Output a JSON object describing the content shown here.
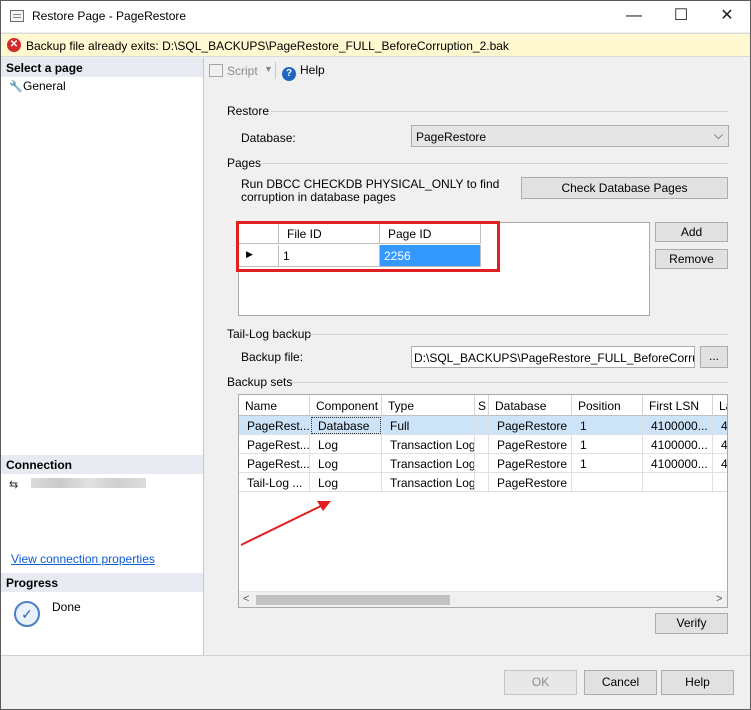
{
  "window": {
    "title": "Restore Page - PageRestore",
    "minimize": "—",
    "maximize": "☐",
    "close": "✕"
  },
  "error_bar": {
    "icon": "error-x-icon",
    "text": "Backup file already exits: D:\\SQL_BACKUPS\\PageRestore_FULL_BeforeCorruption_2.bak"
  },
  "left_panel": {
    "select_header": "Select a page",
    "pages": [
      {
        "label": "General",
        "icon": "wrench-icon"
      }
    ],
    "connection_header": "Connection",
    "connection_link": "View connection properties",
    "progress_header": "Progress",
    "progress_status": "Done"
  },
  "toolbar": {
    "script_label": "Script",
    "help_label": "Help"
  },
  "restore": {
    "section": "Restore",
    "database_label": "Database:",
    "database_value": "PageRestore"
  },
  "pages_section": {
    "section": "Pages",
    "description_line1": "Run DBCC CHECKDB PHYSICAL_ONLY to find",
    "description_line2": "corruption in database pages",
    "check_button": "Check Database Pages",
    "add_button": "Add",
    "remove_button": "Remove",
    "grid": {
      "headers": [
        "File ID",
        "Page ID"
      ],
      "row": {
        "file_id": "1",
        "page_id": "2256"
      }
    }
  },
  "tail_log": {
    "section": "Tail-Log backup",
    "backup_file_label": "Backup file:",
    "backup_file_value": "D:\\SQL_BACKUPS\\PageRestore_FULL_BeforeCorruption_",
    "browse_button": "..."
  },
  "backup_sets": {
    "section": "Backup sets",
    "headers": [
      "Name",
      "Component",
      "Type",
      "S",
      "Database",
      "Position",
      "First LSN",
      "La"
    ],
    "rows": [
      [
        "PageRest...",
        "Database",
        "Full",
        "",
        "PageRestore",
        "1",
        "4100000...",
        "4"
      ],
      [
        "PageRest...",
        "Log",
        "Transaction Log",
        "",
        "PageRestore",
        "1",
        "4100000...",
        "4"
      ],
      [
        "PageRest...",
        "Log",
        "Transaction Log",
        "",
        "PageRestore",
        "1",
        "4100000...",
        "4"
      ],
      [
        "Tail-Log ...",
        "Log",
        "Transaction Log",
        "",
        "PageRestore",
        "",
        "",
        ""
      ]
    ],
    "verify_button": "Verify"
  },
  "footer": {
    "ok": "OK",
    "cancel": "Cancel",
    "help": "Help"
  },
  "colors": {
    "selection": "#3399ff",
    "row_highlight": "#cde3f7",
    "annotation_red": "#e02020",
    "error_bg": "#fff8d0"
  }
}
